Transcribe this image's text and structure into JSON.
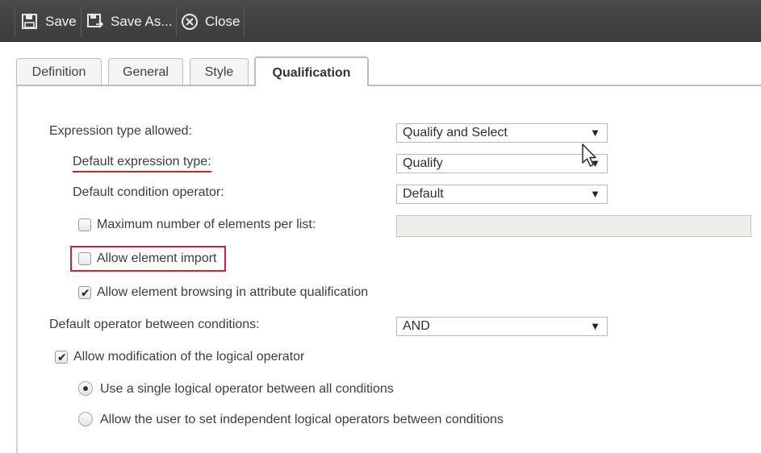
{
  "toolbar": {
    "save": "Save",
    "save_as": "Save As...",
    "close": "Close"
  },
  "tabs": [
    {
      "label": "Definition",
      "active": false
    },
    {
      "label": "General",
      "active": false
    },
    {
      "label": "Style",
      "active": false
    },
    {
      "label": "Qualification",
      "active": true
    }
  ],
  "form": {
    "expression_type_allowed": {
      "label": "Expression type allowed:",
      "value": "Qualify and Select"
    },
    "default_expression_type": {
      "label": "Default expression type:",
      "value": "Qualify"
    },
    "default_condition_operator": {
      "label": "Default condition operator:",
      "value": "Default"
    },
    "max_elements": {
      "label": "Maximum number of elements per list:",
      "checked": false,
      "value": ""
    },
    "allow_element_import": {
      "label": "Allow element import",
      "checked": false
    },
    "allow_element_browsing": {
      "label": "Allow element browsing in attribute qualification",
      "checked": true
    },
    "default_operator_between": {
      "label": "Default operator between conditions:",
      "value": "AND"
    },
    "allow_modification": {
      "label": "Allow modification of the logical operator",
      "checked": true
    },
    "radio_single": {
      "label": "Use a single logical operator between all conditions",
      "selected": true
    },
    "radio_independent": {
      "label": "Allow the user to set independent logical operators between conditions",
      "selected": false
    }
  },
  "icons": {
    "arrow": "▼",
    "check": "✔"
  },
  "colors": {
    "annotation_red": "#d21f2b"
  }
}
